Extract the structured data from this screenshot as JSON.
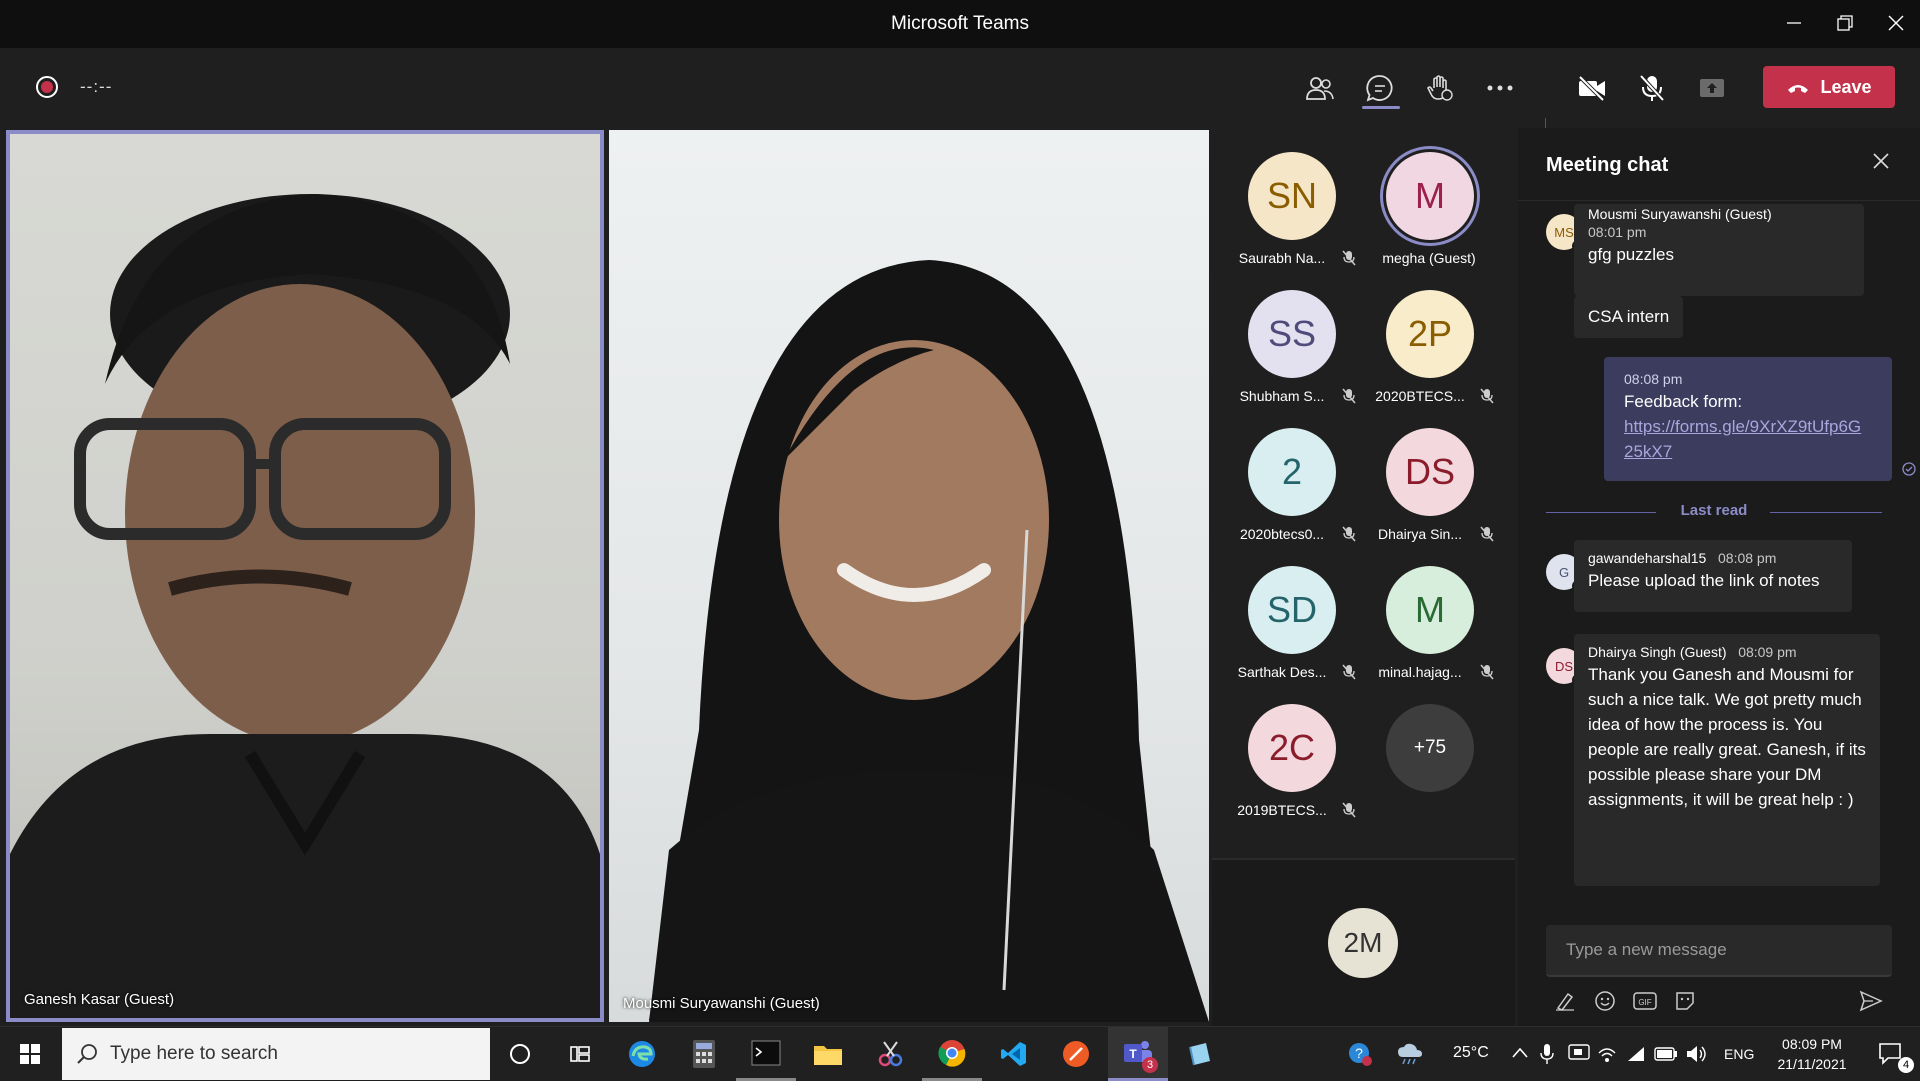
{
  "window": {
    "title": "Microsoft Teams"
  },
  "toolbar": {
    "timer": "--:--",
    "leave_label": "Leave"
  },
  "tiles": [
    {
      "name": "Ganesh Kasar (Guest)"
    },
    {
      "name": "Mousmi Suryawanshi (Guest)"
    }
  ],
  "roster": [
    {
      "initials": "SN",
      "label": "Saurabh Na...",
      "bg": "#f6e6c8",
      "fg": "#8a5d00",
      "muted": true
    },
    {
      "initials": "M",
      "label": "megha (Guest)",
      "bg": "#f1d7e2",
      "fg": "#9c1f4c",
      "muted": false,
      "speaking": true
    },
    {
      "initials": "SS",
      "label": "Shubham S...",
      "bg": "#e3e0f0",
      "fg": "#4f4b7a",
      "muted": true
    },
    {
      "initials": "2P",
      "label": "2020BTECS...",
      "bg": "#f9eccb",
      "fg": "#8a5d00",
      "muted": true
    },
    {
      "initials": "2",
      "label": "2020btecs0...",
      "bg": "#d8eef0",
      "fg": "#26646b",
      "muted": true
    },
    {
      "initials": "DS",
      "label": "Dhairya Sin...",
      "bg": "#f3d9dd",
      "fg": "#8b1c2c",
      "muted": true
    },
    {
      "initials": "SD",
      "label": "Sarthak Des...",
      "bg": "#d8eef0",
      "fg": "#26646b",
      "muted": true
    },
    {
      "initials": "M",
      "label": "minal.hajag...",
      "bg": "#d6eedb",
      "fg": "#2a6b35",
      "muted": true
    },
    {
      "initials": "2C",
      "label": "2019BTECS...",
      "bg": "#f3d9dd",
      "fg": "#8b1c2c",
      "muted": true
    },
    {
      "initials": "+75",
      "label": "",
      "bg": "#3d3d3d",
      "fg": "#ffffff",
      "muted": false
    }
  ],
  "overflow_tile": {
    "initials": "2M"
  },
  "chat": {
    "title": "Meeting chat",
    "messages": [
      {
        "avatar": "MS",
        "sender": "Mousmi Suryawanshi (Guest)",
        "time": "08:01 pm",
        "text": "gfg puzzles"
      },
      {
        "text": "CSA intern"
      },
      {
        "own": true,
        "time": "08:08 pm",
        "text": "Feedback form:",
        "link": "https://forms.gle/9XrXZ9tUfp6G25kX7",
        "link_line1": "https://forms.gle/9XrXZ9tUfp6G",
        "link_line2": "25kX7"
      },
      {
        "avatar": "G",
        "sender": "gawandeharshal15",
        "time": "08:08 pm",
        "text": "Please upload the link of notes"
      },
      {
        "avatar": "DS",
        "sender": "Dhairya Singh (Guest)",
        "time": "08:09 pm",
        "text": "Thank you Ganesh and Mousmi for such a nice talk. We got pretty much idea of how the process is. You people are really great. Ganesh, if its possible please share your DM assignments, it will be great help : )"
      }
    ],
    "last_read_label": "Last read",
    "compose_placeholder": "Type a new message"
  },
  "taskbar": {
    "search_placeholder": "Type here to search",
    "teams_badge": "3",
    "weather": "25°C",
    "language": "ENG",
    "time": "08:09 PM",
    "date": "21/11/2021",
    "notification_count": "4"
  },
  "colors": {
    "accent": "#6264a7",
    "leave": "#c4314b",
    "own_message": "#3b3c5e"
  }
}
